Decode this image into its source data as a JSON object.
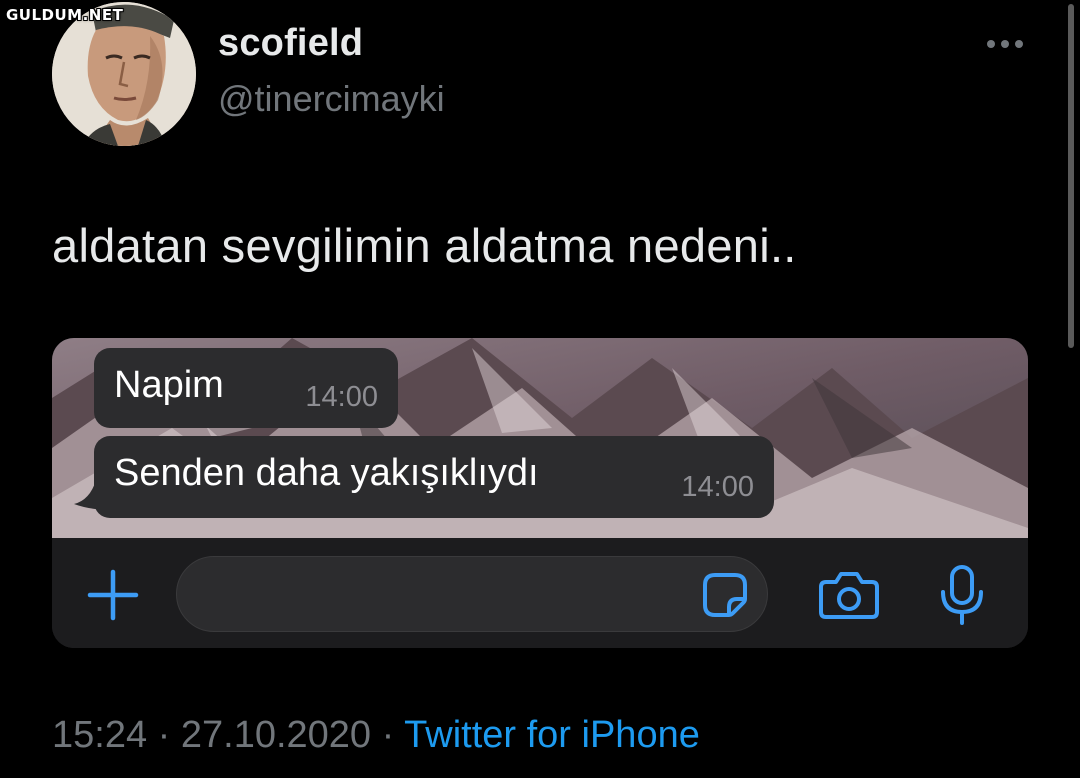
{
  "watermark": "GULDUM.NET",
  "author": {
    "display_name": "scofield",
    "handle": "@tinercimayki"
  },
  "tweet": {
    "text": "aldatan sevgilimin aldatma nedeni.."
  },
  "chat": {
    "messages": [
      {
        "text": "Napim",
        "time": "14:00"
      },
      {
        "text": "Senden daha yakışıklıydı",
        "time": "14:00"
      }
    ],
    "input_icons": [
      "plus-icon",
      "sticker-icon",
      "camera-icon",
      "microphone-icon"
    ]
  },
  "meta": {
    "time": "15:24",
    "separator": " · ",
    "date": "27.10.2020",
    "source": "Twitter for iPhone"
  },
  "colors": {
    "background": "#000000",
    "text_primary": "#e7e9ea",
    "text_secondary": "#71767b",
    "link_blue": "#1d9bf0",
    "ios_accent_blue": "#3d9cf5",
    "bubble": "#2c2c2e"
  }
}
